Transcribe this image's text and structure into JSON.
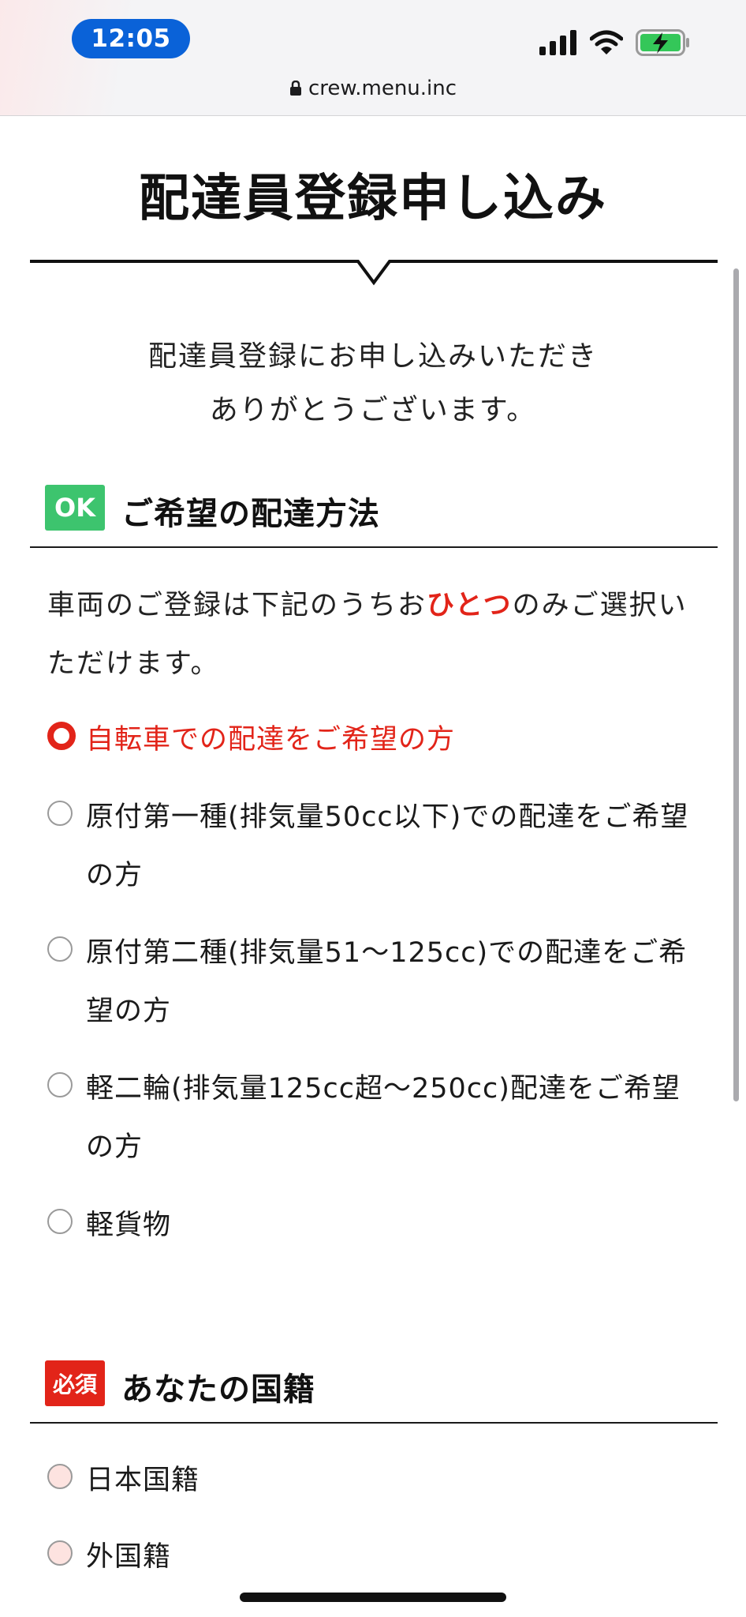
{
  "status_bar": {
    "time": "12:05",
    "url": "crew.menu.inc",
    "icons": [
      "signal-icon",
      "wifi-icon",
      "battery-charging-icon",
      "lock-icon"
    ]
  },
  "page": {
    "title": "配達員登録申し込み",
    "intro_line1": "配達員登録にお申し込みいただき",
    "intro_line2": "ありがとうございます。"
  },
  "vehicle_section": {
    "badge": "OK",
    "title": "ご希望の配達方法",
    "note_before": "車両のご登録は下記のうちお",
    "note_emphasis": "ひとつ",
    "note_after": "のみご選択いただけます。",
    "options": [
      {
        "label": "自転車での配達をご希望の方",
        "selected": true
      },
      {
        "label": "原付第一種(排気量50cc以下)での配達をご希望の方",
        "selected": false
      },
      {
        "label": "原付第二種(排気量51〜125cc)での配達をご希望の方",
        "selected": false
      },
      {
        "label": "軽二輪(排気量125cc超〜250cc)配達をご希望の方",
        "selected": false
      },
      {
        "label": "軽貨物",
        "selected": false
      }
    ]
  },
  "nationality_section": {
    "badge": "必須",
    "title": "あなたの国籍",
    "options": [
      {
        "label": "日本国籍",
        "selected": false
      },
      {
        "label": "外国籍",
        "selected": false
      }
    ]
  },
  "colors": {
    "accent_red": "#e22419",
    "ok_green": "#3dc46e",
    "time_pill_blue": "#0a62d8",
    "battery_green": "#34c759"
  }
}
